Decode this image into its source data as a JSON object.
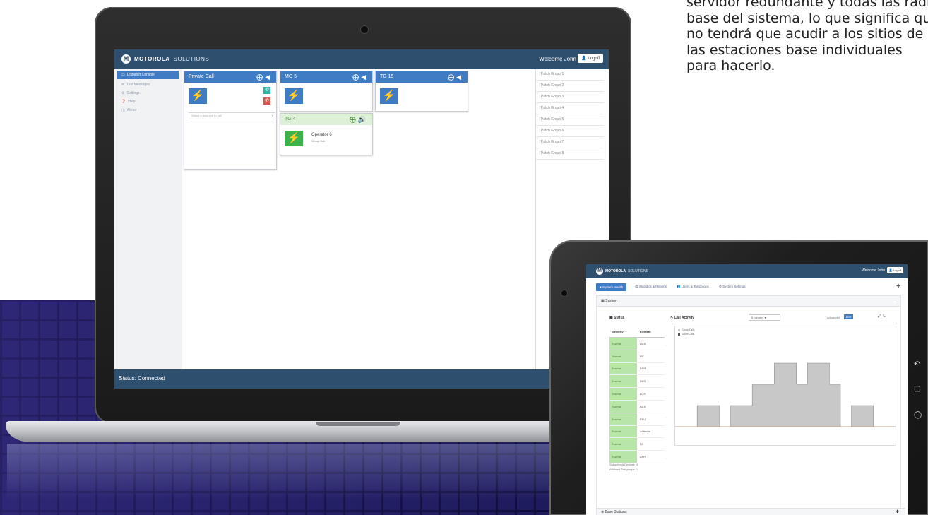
{
  "marketing_text": [
    "servidor redundante y todas las radio",
    "base del sistema, lo que significa que",
    "no tendrá que acudir a los sitios de",
    "las estaciones base individuales",
    "para hacerlo."
  ],
  "laptop": {
    "brand_name": "MOTOROLA",
    "brand_sub": "SOLUTIONS",
    "welcome": "Welcome John",
    "logout": "Logoff",
    "nav": [
      {
        "label": "Dispatch Console",
        "icon": "monitor-icon"
      },
      {
        "label": "Text Messages",
        "icon": "message-icon"
      },
      {
        "label": "Settings",
        "icon": "gear-icon"
      },
      {
        "label": "Help",
        "icon": "help-icon"
      },
      {
        "label": "About",
        "icon": "info-icon"
      }
    ],
    "cards": [
      {
        "title": "Private Call",
        "select_placeholder": "Select a resource to call"
      },
      {
        "title": "MG 5"
      },
      {
        "title": "TG 15"
      },
      {
        "title": "TG 4",
        "operator": "Operator 6",
        "call_type": "Group Call"
      }
    ],
    "patch_groups": [
      "Patch Group 1",
      "Patch Group 2",
      "Patch Group 3",
      "Patch Group 4",
      "Patch Group 5",
      "Patch Group 6",
      "Patch Group 7",
      "Patch Group 8"
    ],
    "status": "Status: Connected"
  },
  "tablet": {
    "brand_name": "MOTOROLA",
    "brand_sub": "SOLUTIONS",
    "welcome": "Welcome John",
    "logout": "Logoff",
    "tabs": [
      "System Health",
      "Statistics & Reports",
      "Users & Talkgroups",
      "System Settings"
    ],
    "system_panel": "System",
    "status_title": "Status",
    "table_headers": [
      "Severity",
      "Element"
    ],
    "rows": [
      {
        "severity": "Normal",
        "element": "DCS"
      },
      {
        "severity": "Normal",
        "element": "RC"
      },
      {
        "severity": "Normal",
        "element": "BSR"
      },
      {
        "severity": "Normal",
        "element": "BCS"
      },
      {
        "severity": "Normal",
        "element": "LCS"
      },
      {
        "severity": "Normal",
        "element": "BCS"
      },
      {
        "severity": "Normal",
        "element": "PSU"
      },
      {
        "severity": "Normal",
        "element": "Antenna"
      },
      {
        "severity": "Normal",
        "element": "PA"
      },
      {
        "severity": "Normal",
        "element": "AFR"
      }
    ],
    "subscribed_text": "Subscribed Devices: 4",
    "affiliated_text": "Affiliated Talkgroups: 1",
    "call_activity": "Call Activity",
    "period": "5 minutes",
    "advanced": "Advanced",
    "live": "Live",
    "base_stations": "Base Stations"
  },
  "chart_data": {
    "type": "area",
    "title": "Call Activity",
    "series": [
      {
        "name": "Group Calls",
        "color": "#c8c8c8",
        "values": [
          0,
          0,
          1,
          1,
          0,
          1,
          1,
          2,
          2,
          3,
          3,
          2,
          3,
          3,
          2,
          0,
          1,
          1,
          0,
          0
        ]
      },
      {
        "name": "Active Calls",
        "color": "#555555",
        "values": [
          0,
          0,
          0,
          0,
          0,
          0,
          0,
          0,
          0,
          0,
          0,
          0,
          0,
          0,
          0,
          0,
          0,
          0,
          0,
          0
        ]
      }
    ],
    "ylim": [
      0,
      10
    ],
    "grid": false,
    "legend": "top-left"
  },
  "colors": {
    "topbar": "#2f4f6f",
    "accent": "#3f7cc4",
    "ok": "#b8e6a8",
    "call_green": "#3bb24a"
  }
}
